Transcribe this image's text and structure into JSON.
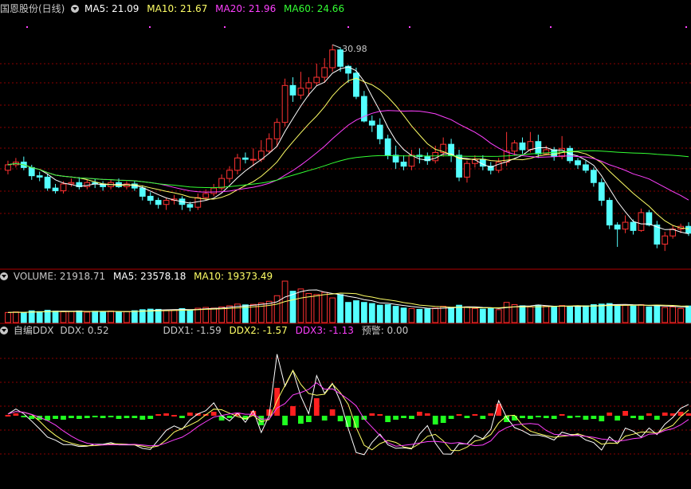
{
  "colors": {
    "up": "#ff3232",
    "down": "#54ffff",
    "ma5": "#ffffff",
    "ma10": "#ffff66",
    "ma20": "#ff40ff",
    "ma60": "#33ff33",
    "grid": "#8c0000",
    "label": "#c8c8c8"
  },
  "price_panel": {
    "title": "国恩股份(日线)",
    "ma5": "MA5: 21.09",
    "ma10": "MA10: 21.67",
    "ma20": "MA20: 21.96",
    "ma60": "MA60: 24.66",
    "high_label": "30.98"
  },
  "volume_panel": {
    "title": "VOLUME: 21918.71",
    "ma5": "MA5: 23578.18",
    "ma10": "MA10: 19373.49"
  },
  "ddx_panel": {
    "title": "自编DDX",
    "ddx": "DDX: 0.52",
    "ddx1": "DDX1: -1.59",
    "ddx2": "DDX2: -1.57",
    "ddx3": "DDX3: -1.13",
    "alarm": "预警: 0.00"
  },
  "chart_data": {
    "type": "candlestick",
    "title": "国恩股份(日线)",
    "price_range": [
      15.5,
      33.2
    ],
    "candles": [
      [
        21.8,
        22.2,
        22.5,
        21.5
      ],
      [
        22.2,
        22.4,
        22.7,
        22.0
      ],
      [
        22.4,
        22.0,
        22.8,
        21.8
      ],
      [
        22.0,
        21.4,
        22.2,
        21.1
      ],
      [
        21.4,
        21.3,
        21.7,
        21.0
      ],
      [
        21.3,
        20.5,
        21.5,
        20.3
      ],
      [
        20.5,
        20.3,
        20.8,
        20.1
      ],
      [
        20.3,
        20.8,
        21.0,
        20.1
      ],
      [
        20.8,
        20.9,
        21.2,
        20.6
      ],
      [
        20.9,
        20.6,
        21.3,
        20.4
      ],
      [
        20.6,
        20.9,
        21.1,
        20.4
      ],
      [
        20.9,
        20.8,
        21.2,
        20.5
      ],
      [
        20.8,
        20.6,
        21.0,
        20.3
      ],
      [
        20.6,
        20.9,
        21.1,
        20.4
      ],
      [
        20.9,
        20.6,
        21.2,
        20.5
      ],
      [
        20.6,
        20.8,
        21.0,
        20.4
      ],
      [
        20.8,
        20.5,
        21.0,
        20.3
      ],
      [
        20.5,
        19.9,
        20.7,
        19.6
      ],
      [
        19.9,
        19.6,
        20.2,
        19.3
      ],
      [
        19.6,
        19.3,
        19.8,
        19.0
      ],
      [
        19.3,
        19.6,
        19.8,
        18.9
      ],
      [
        19.6,
        19.7,
        20.0,
        19.3
      ],
      [
        19.7,
        19.3,
        19.9,
        18.9
      ],
      [
        19.3,
        19.1,
        19.5,
        18.8
      ],
      [
        19.1,
        19.8,
        20.1,
        18.9
      ],
      [
        19.8,
        20.1,
        20.4,
        19.6
      ],
      [
        20.1,
        20.5,
        20.8,
        19.9
      ],
      [
        20.5,
        21.2,
        21.5,
        20.3
      ],
      [
        21.2,
        21.8,
        22.1,
        20.9
      ],
      [
        21.8,
        22.7,
        23.0,
        21.5
      ],
      [
        22.7,
        22.6,
        23.1,
        22.3
      ],
      [
        22.6,
        22.6,
        23.4,
        22.1
      ],
      [
        22.6,
        23.2,
        24.0,
        22.4
      ],
      [
        23.2,
        24.1,
        24.5,
        23.0
      ],
      [
        24.1,
        25.3,
        25.6,
        23.5
      ],
      [
        25.3,
        28.0,
        28.5,
        25.0
      ],
      [
        28.0,
        27.3,
        28.6,
        26.8
      ],
      [
        27.3,
        27.8,
        29.0,
        27.0
      ],
      [
        27.8,
        28.2,
        28.6,
        27.2
      ],
      [
        28.2,
        28.6,
        29.6,
        28.0
      ],
      [
        28.6,
        29.3,
        30.0,
        28.2
      ],
      [
        29.3,
        30.6,
        30.98,
        29.0
      ],
      [
        30.6,
        29.4,
        30.8,
        29.0
      ],
      [
        29.4,
        28.9,
        29.5,
        28.2
      ],
      [
        28.9,
        27.2,
        29.3,
        27.0
      ],
      [
        27.2,
        25.4,
        27.6,
        25.3
      ],
      [
        25.4,
        25.1,
        25.8,
        24.6
      ],
      [
        25.1,
        24.1,
        25.6,
        23.7
      ],
      [
        24.1,
        22.9,
        24.4,
        22.6
      ],
      [
        22.9,
        22.4,
        23.6,
        21.9
      ],
      [
        22.4,
        22.1,
        22.9,
        21.8
      ],
      [
        22.1,
        22.9,
        23.3,
        21.8
      ],
      [
        22.9,
        22.8,
        23.4,
        22.3
      ],
      [
        22.8,
        22.5,
        23.1,
        22.2
      ],
      [
        22.5,
        23.1,
        23.6,
        22.3
      ],
      [
        23.1,
        23.7,
        24.2,
        22.8
      ],
      [
        23.7,
        22.9,
        24.1,
        22.4
      ],
      [
        22.9,
        21.3,
        23.3,
        21.0
      ],
      [
        21.3,
        22.3,
        22.5,
        20.9
      ],
      [
        22.3,
        22.6,
        22.9,
        22.0
      ],
      [
        22.6,
        22.1,
        22.9,
        21.8
      ],
      [
        22.1,
        21.8,
        22.4,
        21.5
      ],
      [
        21.8,
        22.4,
        22.7,
        21.6
      ],
      [
        22.4,
        23.2,
        24.6,
        22.1
      ],
      [
        23.2,
        23.8,
        24.0,
        22.9
      ],
      [
        23.8,
        23.3,
        24.2,
        23.0
      ],
      [
        23.3,
        23.9,
        24.6,
        23.1
      ],
      [
        23.9,
        23.0,
        24.4,
        22.7
      ],
      [
        23.0,
        23.3,
        23.6,
        22.9
      ],
      [
        23.3,
        22.8,
        23.5,
        22.5
      ],
      [
        22.8,
        23.4,
        24.3,
        22.6
      ],
      [
        23.4,
        22.5,
        23.6,
        22.3
      ],
      [
        22.5,
        22.2,
        22.7,
        21.9
      ],
      [
        22.2,
        21.8,
        22.5,
        21.6
      ],
      [
        21.8,
        20.9,
        22.0,
        20.6
      ],
      [
        20.9,
        19.6,
        21.2,
        19.2
      ],
      [
        19.6,
        17.8,
        19.8,
        17.5
      ],
      [
        17.8,
        17.5,
        18.0,
        16.2
      ],
      [
        17.5,
        18.0,
        18.5,
        17.2
      ],
      [
        18.0,
        17.4,
        18.2,
        17.1
      ],
      [
        17.4,
        18.7,
        19.0,
        17.3
      ],
      [
        18.7,
        17.8,
        18.9,
        17.7
      ],
      [
        17.8,
        16.4,
        18.1,
        16.1
      ],
      [
        16.4,
        17.0,
        17.3,
        15.9
      ],
      [
        17.0,
        17.5,
        17.8,
        16.8
      ],
      [
        17.5,
        17.7,
        17.9,
        17.2
      ],
      [
        17.7,
        17.2,
        18.0,
        17.0
      ]
    ],
    "volume": [
      9000,
      9500,
      8800,
      10500,
      9800,
      11000,
      10200,
      9600,
      9900,
      10400,
      9300,
      10100,
      9700,
      10300,
      9200,
      9800,
      10600,
      11500,
      12000,
      11800,
      10900,
      11300,
      12500,
      11200,
      12800,
      13500,
      12900,
      14000,
      15000,
      16500,
      15800,
      16200,
      17500,
      19000,
      24000,
      37000,
      28000,
      30000,
      26000,
      25000,
      27000,
      22000,
      25000,
      18000,
      19500,
      18000,
      17000,
      15500,
      16000,
      14500,
      13000,
      12500,
      11800,
      12200,
      13000,
      14500,
      13500,
      15500,
      14000,
      12600,
      12000,
      12800,
      11500,
      18000,
      16000,
      15000,
      14000,
      15500,
      14800,
      13800,
      15200,
      14000,
      14500,
      15000,
      16000,
      16500,
      17000,
      16000,
      15500,
      14800,
      16000,
      14000,
      15500,
      13500,
      14000,
      12500,
      14800
    ],
    "ddx": [
      0.1,
      0.3,
      -0.2,
      -0.4,
      -0.5,
      -0.6,
      -0.4,
      -0.5,
      -0.3,
      -0.4,
      -0.3,
      -0.2,
      -0.3,
      -0.2,
      -0.4,
      -0.3,
      -0.3,
      -0.5,
      -0.4,
      0.2,
      0.3,
      0.1,
      -0.3,
      0.4,
      0.3,
      0.2,
      0.5,
      -0.6,
      -0.3,
      0.4,
      -0.5,
      0.6,
      -1.2,
      0.8,
      3.5,
      -1.2,
      1.2,
      -1.0,
      -0.8,
      2.2,
      -0.6,
      0.8,
      -0.7,
      -1.4,
      -1.5,
      -0.5,
      0.3,
      0.2,
      -0.8,
      -0.5,
      -0.3,
      -0.4,
      0.5,
      0.3,
      -1.1,
      -0.9,
      -0.4,
      0.2,
      -0.3,
      0.2,
      -0.4,
      0.3,
      1.5,
      -0.8,
      -0.6,
      -0.3,
      -0.4,
      -0.2,
      -0.3,
      -0.4,
      0.2,
      -0.3,
      -0.2,
      -0.5,
      -0.4,
      -0.7,
      0.4,
      -0.6,
      0.6,
      -0.3,
      -0.5,
      0.3,
      -0.5,
      0.4,
      0.3,
      0.5,
      0.3
    ]
  }
}
